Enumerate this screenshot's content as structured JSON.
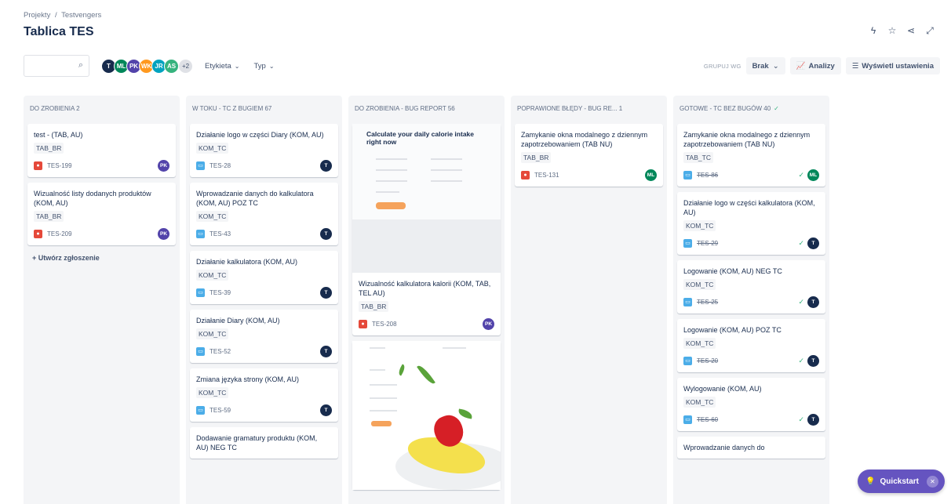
{
  "breadcrumb": {
    "projects": "Projekty",
    "sep": "/",
    "project": "Testvengers"
  },
  "title": "Tablica TES",
  "top_icons": [
    "lightning-icon",
    "star-icon",
    "share-icon",
    "expand-icon"
  ],
  "filters": {
    "search_placeholder": "",
    "avatars": [
      {
        "initials": "T",
        "color": "#172b4d"
      },
      {
        "initials": "ML",
        "color": "#00875a"
      },
      {
        "initials": "PK",
        "color": "#5243aa"
      },
      {
        "initials": "WK",
        "color": "#ff991f"
      },
      {
        "initials": "JR",
        "color": "#00a3bf"
      },
      {
        "initials": "AS",
        "color": "#36b37e"
      }
    ],
    "more": "+2",
    "label_filter": "Etykieta",
    "type_filter": "Typ",
    "group_label": "GRUPUJ WG",
    "group_value": "Brak",
    "insights": "Analizy",
    "view_settings": "Wyświetl ustawienia"
  },
  "columns": [
    {
      "header": "DO ZROBIENIA 2",
      "done": false,
      "cards": [
        {
          "title": "test - (TAB, AU)",
          "label": "TAB_BR",
          "type": "bug",
          "key": "TES-199",
          "done": false,
          "avatar": "PK",
          "avatar_color": "#5243aa"
        },
        {
          "title": "Wizualność listy dodanych produktów (KOM, AU)",
          "label": "TAB_BR",
          "type": "bug",
          "key": "TES-209",
          "done": false,
          "avatar": "PK",
          "avatar_color": "#5243aa"
        }
      ],
      "create": "+ Utwórz zgłoszenie"
    },
    {
      "header": "W TOKU - TC Z BUGIEM 67",
      "done": false,
      "cards": [
        {
          "title": "Działanie logo w części Diary (KOM, AU)",
          "label": "KOM_TC",
          "type": "test",
          "key": "TES-28",
          "done": false,
          "avatar": "T",
          "avatar_color": "#172b4d"
        },
        {
          "title": "Wprowadzanie danych do kalkulatora (KOM, AU) POZ TC",
          "label": "KOM_TC",
          "type": "test",
          "key": "TES-43",
          "done": false,
          "avatar": "T",
          "avatar_color": "#172b4d"
        },
        {
          "title": "Działanie kalkulatora (KOM, AU)",
          "label": "KOM_TC",
          "type": "test",
          "key": "TES-39",
          "done": false,
          "avatar": "T",
          "avatar_color": "#172b4d"
        },
        {
          "title": "Działanie Diary (KOM, AU)",
          "label": "KOM_TC",
          "type": "test",
          "key": "TES-52",
          "done": false,
          "avatar": "T",
          "avatar_color": "#172b4d"
        },
        {
          "title": "Zmiana języka strony (KOM, AU)",
          "label": "KOM_TC",
          "type": "test",
          "key": "TES-59",
          "done": false,
          "avatar": "T",
          "avatar_color": "#172b4d"
        },
        {
          "title": "Dodawanie gramatury produktu (KOM, AU) NEG TC",
          "label": "",
          "type": "test",
          "key": "",
          "done": false,
          "avatar": "",
          "avatar_color": "#172b4d"
        }
      ]
    },
    {
      "header": "DO ZROBIENIA - BUG REPORT 56",
      "done": false,
      "cards": [
        {
          "image": "calorie-calculator-screenshot",
          "image_heading": "Calculate your daily calorie intake right now",
          "title": "Wizualność kalkulatora kalorii (KOM, TAB, TEL AU)",
          "label": "TAB_BR",
          "type": "bug",
          "key": "TES-208",
          "done": false,
          "avatar": "PK",
          "avatar_color": "#5243aa"
        },
        {
          "image": "fruit-page-screenshot",
          "title": "",
          "label": "",
          "type": "",
          "key": "",
          "done": false,
          "avatar": ""
        }
      ]
    },
    {
      "header": "POPRAWIONE BŁĘDY - BUG RE... 1",
      "done": false,
      "cards": [
        {
          "title": "Zamykanie okna modalnego z dziennym zapotrzebowaniem (TAB NU)",
          "label": "TAB_BR",
          "type": "bug",
          "key": "TES-131",
          "done": false,
          "avatar": "ML",
          "avatar_color": "#00875a"
        }
      ]
    },
    {
      "header": "GOTOWE - TC BEZ BUGÓW 40",
      "done": true,
      "cards": [
        {
          "title": "Zamykanie okna modalnego z dziennym zapotrzebowaniem (TAB NU)",
          "label": "TAB_TC",
          "type": "test",
          "key": "TES-86",
          "done": true,
          "avatar": "ML",
          "avatar_color": "#00875a"
        },
        {
          "title": "Działanie logo w części kalkulatora (KOM, AU)",
          "label": "KOM_TC",
          "type": "test",
          "key": "TES-29",
          "done": true,
          "avatar": "T",
          "avatar_color": "#172b4d"
        },
        {
          "title": "Logowanie (KOM, AU) NEG TC",
          "label": "KOM_TC",
          "type": "test",
          "key": "TES-25",
          "done": true,
          "avatar": "T",
          "avatar_color": "#172b4d"
        },
        {
          "title": "Logowanie (KOM, AU) POZ TC",
          "label": "KOM_TC",
          "type": "test",
          "key": "TES-20",
          "done": true,
          "avatar": "T",
          "avatar_color": "#172b4d"
        },
        {
          "title": "Wylogowanie (KOM, AU)",
          "label": "KOM_TC",
          "type": "test",
          "key": "TES-60",
          "done": true,
          "avatar": "T",
          "avatar_color": "#172b4d"
        },
        {
          "title": "Wprowadzanie danych do",
          "label": "",
          "type": "",
          "key": "",
          "done": false,
          "avatar": ""
        }
      ]
    }
  ],
  "quickstart": "Quickstart"
}
